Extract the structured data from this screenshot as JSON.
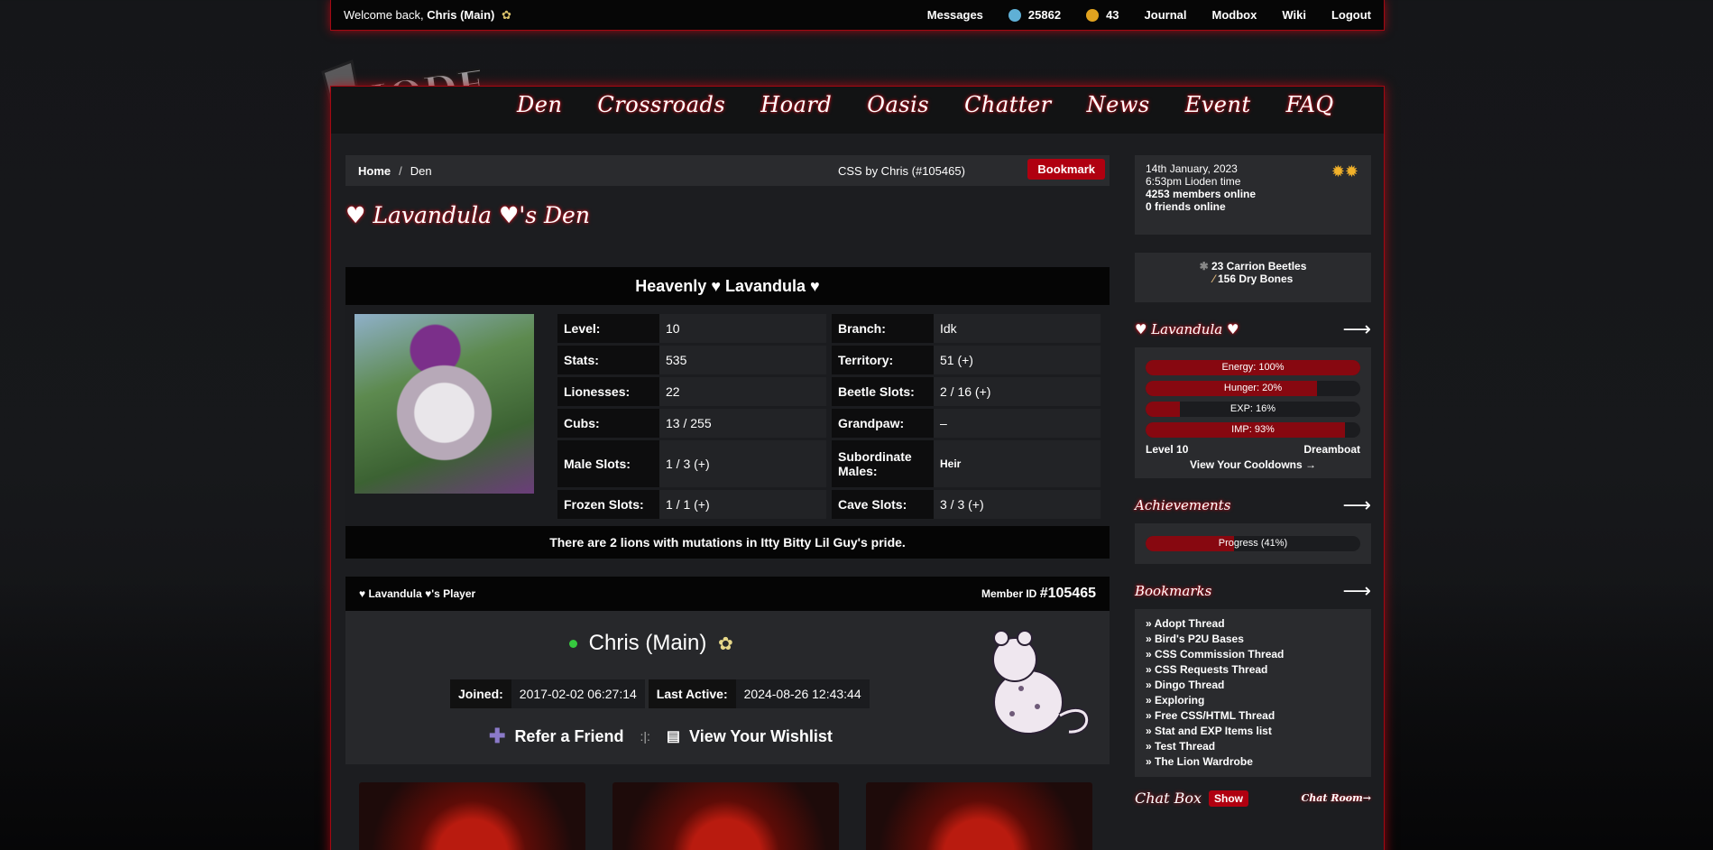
{
  "topbar": {
    "welcome_prefix": "Welcome back,",
    "user": "Chris (Main)",
    "messages": "Messages",
    "beetles_count": "25862",
    "gold_count": "43",
    "journal": "Journal",
    "modbox": "Modbox",
    "wiki": "Wiki",
    "logout": "Logout"
  },
  "nav": {
    "logo": "LIODEN",
    "items": [
      "Den",
      "Crossroads",
      "Hoard",
      "Oasis",
      "Chatter",
      "News",
      "Event",
      "FAQ"
    ]
  },
  "breadcrumb": {
    "home": "Home",
    "sep": "/",
    "current": "Den",
    "css_by": "CSS by Chris (#105465)",
    "bookmark": "Bookmark"
  },
  "den_title": "♥ Lavandula ♥'s Den",
  "lion": {
    "name": "Heavenly ♥ Lavandula ♥",
    "stats_left": [
      {
        "k": "Level:",
        "v": "10"
      },
      {
        "k": "Stats:",
        "v": "535"
      },
      {
        "k": "Lionesses:",
        "v": "22"
      },
      {
        "k": "Cubs:",
        "v": "13 / 255"
      },
      {
        "k": "Male Slots:",
        "v": "1 / 3 (+)"
      },
      {
        "k": "Frozen Slots:",
        "v": "1 / 1 (+)"
      }
    ],
    "stats_right": [
      {
        "k": "Branch:",
        "v": "Idk"
      },
      {
        "k": "Territory:",
        "v": "51 (+)"
      },
      {
        "k": "Beetle Slots:",
        "v": "2 / 16 (+)"
      },
      {
        "k": "Grandpaw:",
        "v": "–"
      },
      {
        "k": "Subordinate Males:",
        "v": "Heir"
      },
      {
        "k": "Cave Slots:",
        "v": "3 / 3 (+)"
      }
    ],
    "mutations": "There are 2 lions with mutations in Itty Bitty Lil Guy's pride."
  },
  "player": {
    "header_left": "♥ Lavandula ♥'s Player",
    "member_label": "Member ID",
    "member_id": "#105465",
    "name": "Chris (Main)",
    "joined_label": "Joined:",
    "joined": "2017-02-02 06:27:14",
    "last_active_label": "Last Active:",
    "last_active": "2024-08-26 12:43:44",
    "refer": "Refer a Friend",
    "divider": ":|:",
    "wishlist": "View Your Wishlist"
  },
  "sidebar": {
    "date": "14th January, 2023",
    "time": "6:53pm Lioden time",
    "members_online": "4253 members online",
    "friends_online": "0 friends online",
    "carrion": "23 Carrion Beetles",
    "dry_bones": "156 Dry Bones",
    "lion_title": "♥ Lavandula ♥",
    "arrow": "⟶",
    "bars": [
      {
        "label": "Energy: 100%",
        "pct": 100
      },
      {
        "label": "Hunger: 20%",
        "pct": 80
      },
      {
        "label": "EXP: 16%",
        "pct": 16
      },
      {
        "label": "IMP: 93%",
        "pct": 93
      }
    ],
    "level": "Level 10",
    "mood": "Dreamboat",
    "cooldowns": "View Your Cooldowns →",
    "achievements_title": "Achievements",
    "progress": {
      "label": "Progress (41%)",
      "pct": 41
    },
    "bookmarks_title": "Bookmarks",
    "bookmarks": [
      "» Adopt Thread",
      "» Bird's P2U Bases",
      "» CSS Commission Thread",
      "» CSS Requests Thread",
      "» Dingo Thread",
      "» Exploring",
      "» Free CSS/HTML Thread",
      "» Stat and EXP Items list",
      "» Test Thread",
      "» The Lion Wardrobe"
    ],
    "chat_title": "Chat Box",
    "show": "Show",
    "chat_room": "Chat Room→"
  },
  "colors": {
    "accent": "#b00010",
    "glow": "#c4101c",
    "online": "#36c93f"
  }
}
